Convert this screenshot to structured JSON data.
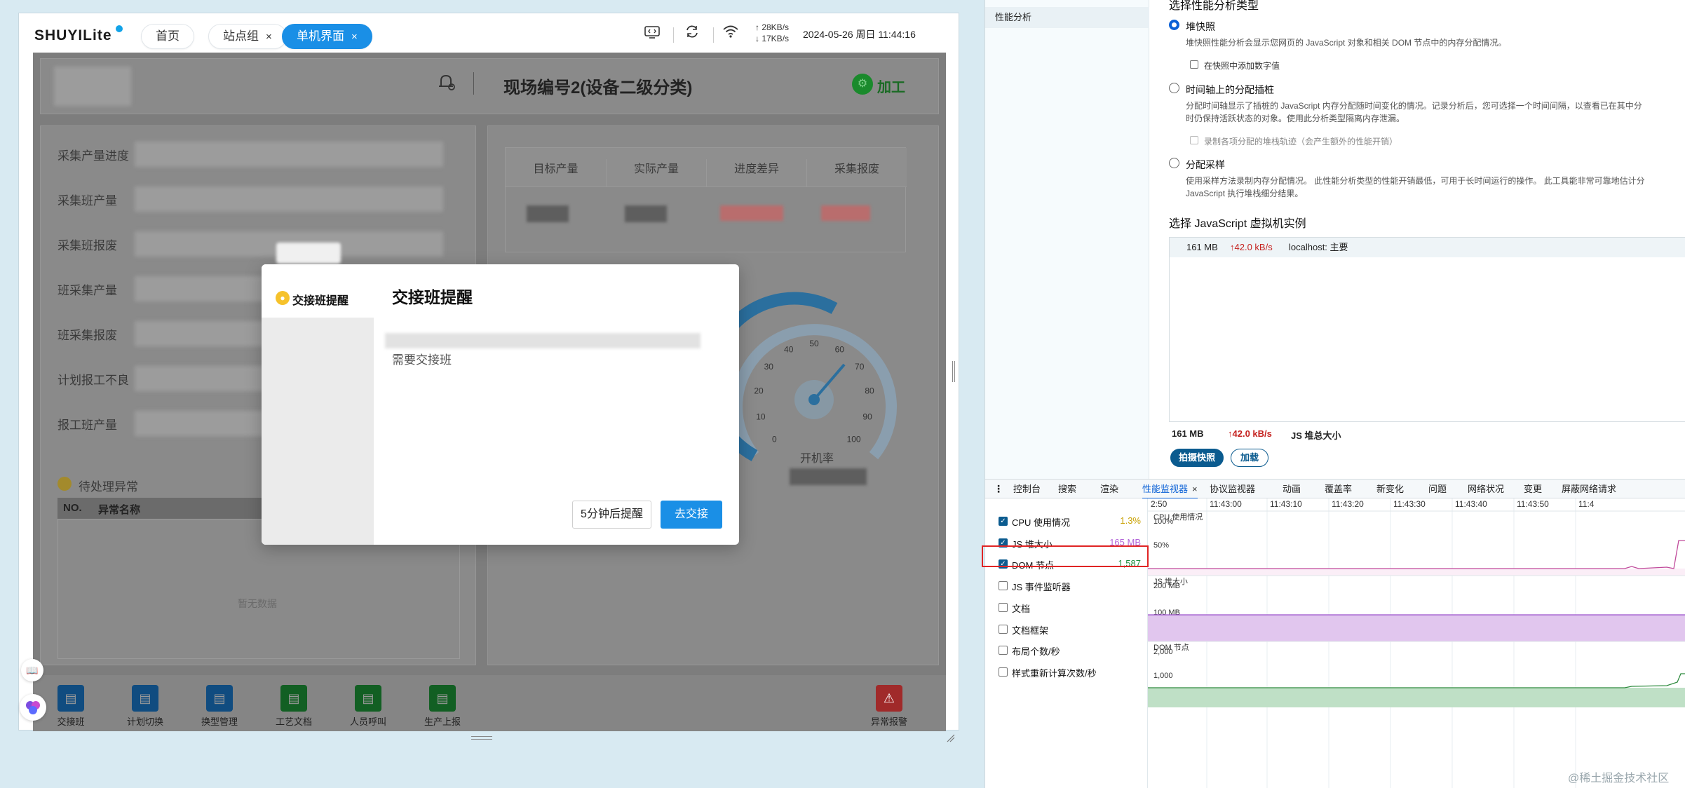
{
  "app": {
    "brand": "SHUYILite",
    "tabs": [
      {
        "label": "首页",
        "closable": false,
        "active": false
      },
      {
        "label": "站点组",
        "closable": true,
        "active": false
      },
      {
        "label": "单机界面",
        "closable": true,
        "active": true
      }
    ],
    "close_glyph": "×",
    "speed_up": "↑ 28KB/s",
    "speed_down": "↓ 17KB/s",
    "datetime": "2024-05-26 周日 11:44:16",
    "header_title": "现场编号2(设备二级分类)",
    "process_button": "加工",
    "left_labels": [
      "采集产量进度",
      "采集班产量",
      "采集班报废",
      "班采集产量",
      "班采集报废",
      "计划报工不良",
      "报工班产量"
    ],
    "table_headers": [
      "目标产量",
      "实际产量",
      "进度差异",
      "采集报废"
    ],
    "pending_title": "待处理异常",
    "pending_cols": [
      "NO.",
      "异常名称"
    ],
    "pending_empty": "暂无数据",
    "gauge_ticks": [
      "0",
      "10",
      "20",
      "30",
      "40",
      "50",
      "60",
      "70",
      "80",
      "90",
      "100"
    ],
    "gauge_label": "开机率",
    "bottom_bar": [
      {
        "label": "交接班",
        "icon": "handover-icon",
        "color": "#1a7fd6"
      },
      {
        "label": "计划切换",
        "icon": "plan-switch-icon",
        "color": "#1a7fd6"
      },
      {
        "label": "换型管理",
        "icon": "changeover-icon",
        "color": "#1a7fd6"
      },
      {
        "label": "工艺文档",
        "icon": "process-doc-icon",
        "color": "#1e9e3a"
      },
      {
        "label": "人员呼叫",
        "icon": "person-call-icon",
        "color": "#1e9e3a"
      },
      {
        "label": "生产上报",
        "icon": "production-report-icon",
        "color": "#1e9e3a"
      }
    ],
    "alarm_label": "异常报警",
    "alarm_color": "#d23131",
    "accent": "#1a8fe6"
  },
  "modal": {
    "side_label": "交接班提醒",
    "title": "交接班提醒",
    "message": "需要交接班",
    "later_button": "5分钟后提醒",
    "go_button": "去交接"
  },
  "devtools": {
    "side_item": "性能分析",
    "section_type_title": "选择性能分析类型",
    "options": [
      {
        "label": "堆快照",
        "selected": true,
        "desc": [
          "堆快照性能分析会显示您网页的 JavaScript 对象和相关 DOM 节点中的内存分配情况。"
        ],
        "checkbox": "在快照中添加数字值",
        "checkbox_disabled": false
      },
      {
        "label": "时间轴上的分配插桩",
        "selected": false,
        "desc": [
          "分配时间轴显示了插桩的 JavaScript 内存分配随时间变化的情况。记录分析后，您可选择一个时间间隔，以查看已在其中分",
          "时仍保持活跃状态的对象。使用此分析类型隔离内存泄漏。"
        ],
        "checkbox": "录制各项分配的堆栈轨迹（会产生额外的性能开销）",
        "checkbox_disabled": true
      },
      {
        "label": "分配采样",
        "selected": false,
        "desc": [
          "使用采样方法录制内存分配情况。 此性能分析类型的性能开销最低，可用于长时间运行的操作。 此工具能非常可靠地估计分",
          "JavaScript 执行堆栈细分结果。"
        ],
        "checkbox": "",
        "checkbox_disabled": false
      }
    ],
    "vm_title": "选择 JavaScript 虚拟机实例",
    "vm_row": {
      "size": "161 MB",
      "rate": "↑42.0 kB/s",
      "target": "localhost: 主要"
    },
    "summary": {
      "size": "161 MB",
      "rate": "↑42.0 kB/s",
      "label": "JS 堆总大小"
    },
    "snapshot_button": "拍摄快照",
    "load_button": "加载",
    "menu_glyph": "⋮",
    "tabs": [
      "控制台",
      "搜索",
      "渲染",
      "性能监视器",
      "协议监视器",
      "动画",
      "覆盖率",
      "新变化",
      "问题",
      "网络状况",
      "变更",
      "屏蔽网络请求"
    ],
    "active_tab": "性能监视器",
    "metrics": [
      {
        "label": "CPU 使用情况",
        "checked": true,
        "value": "1.3%",
        "color": "#c8a000"
      },
      {
        "label": "JS 堆大小",
        "checked": true,
        "value": "165 MB",
        "color": "#b366d9"
      },
      {
        "label": "DOM 节点",
        "checked": true,
        "value": "1,587",
        "color": "#1e8e3e"
      },
      {
        "label": "JS 事件监听器",
        "checked": false,
        "value": "",
        "color": "#333333"
      },
      {
        "label": "文档",
        "checked": false,
        "value": "",
        "color": "#333333"
      },
      {
        "label": "文档框架",
        "checked": false,
        "value": "",
        "color": "#333333"
      },
      {
        "label": "布局个数/秒",
        "checked": false,
        "value": "",
        "color": "#333333"
      },
      {
        "label": "样式重新计算次数/秒",
        "checked": false,
        "value": "",
        "color": "#333333"
      }
    ],
    "time_ticks": [
      "2:50",
      "11:43:00",
      "11:43:10",
      "11:43:20",
      "11:43:30",
      "11:43:40",
      "11:43:50",
      "11:4"
    ],
    "charts": [
      {
        "title": "CPU 使用情况",
        "labels": [
          "100%",
          "50%"
        ],
        "fill": "#fbeef7",
        "line": "#c04a9b"
      },
      {
        "title": "JS 堆大小",
        "labels": [
          "200 MB",
          "100 MB"
        ],
        "fill": "#e1c6ee",
        "line": "#9b4fcb"
      },
      {
        "title": "DOM 节点",
        "labels": [
          "2,000",
          "1,000"
        ],
        "fill": "#bfe0c6",
        "line": "#2e8b3e"
      }
    ]
  },
  "watermark": "@稀土掘金技术社区"
}
